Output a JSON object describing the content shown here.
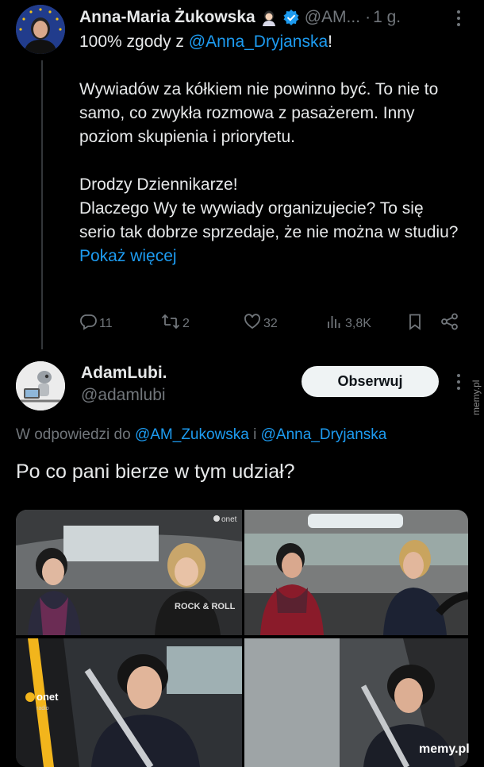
{
  "tweet1": {
    "author_name": "Anna-Maria Żukowska",
    "handle": "@AM...",
    "separator": "·",
    "time": "1 g.",
    "text_line1_prefix": "100% zgody z ",
    "text_line1_mention": "@Anna_Dryjanska",
    "text_line1_suffix": "!",
    "paragraph2": "Wywiadów za kółkiem nie powinno być. To nie to samo, co zwykła rozmowa z pasażerem. Inny poziom skupienia i priorytetu.",
    "paragraph3_line1": "Drodzy Dziennikarze!",
    "paragraph3_rest": "Dlaczego Wy te wywiady organizujecie? To się serio tak dobrze sprzedaje, że nie można w studiu? ",
    "show_more": "Pokaż więcej",
    "replies": "11",
    "retweets": "2",
    "likes": "32",
    "views": "3,8K"
  },
  "tweet2": {
    "author_name": "AdamLubi.",
    "handle": "@adamlubi",
    "follow_label": "Obserwuj",
    "reply_prefix": "W odpowiedzi do ",
    "reply_mention1": "@AM_Zukowska",
    "reply_conj": " i ",
    "reply_mention2": "@Anna_Dryjanska",
    "text": "Po co pani bierze w tym udział?"
  },
  "media": {
    "top_left_shirt": "ROCK & ROLL",
    "top_left_logo": "onet",
    "bottom_left_logo": "onet",
    "bottom_left_logo_sub": "radio"
  },
  "watermark": {
    "side": "memy.pl",
    "bottom": "memy.pl"
  },
  "colors": {
    "background": "#000000",
    "text": "#e7e9ea",
    "secondary": "#71767b",
    "link": "#1d9bf0",
    "verified": "#1d9bf0",
    "follow_bg": "#eff3f4"
  },
  "icons": [
    "verified-badge-icon",
    "more-icon",
    "reply-icon",
    "retweet-icon",
    "like-icon",
    "views-icon",
    "bookmark-icon",
    "share-icon"
  ]
}
